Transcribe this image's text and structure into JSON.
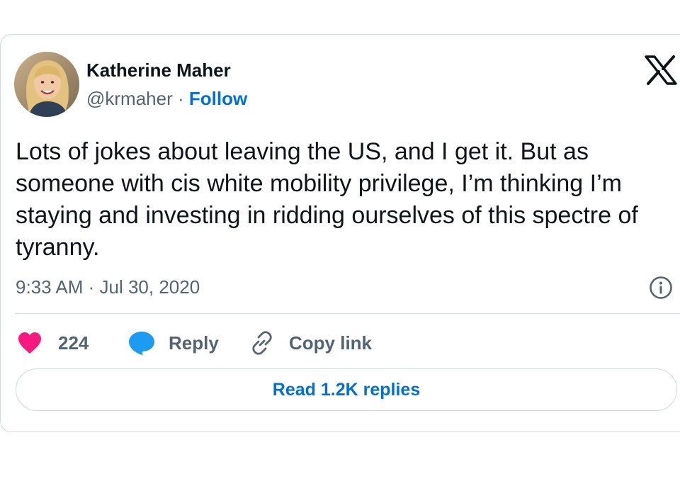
{
  "author": {
    "name": "Katherine Maher",
    "handle": "@krmaher",
    "separator": "·",
    "follow_label": "Follow"
  },
  "tweet": {
    "text": "Lots of jokes about leaving the US, and I get it. But as someone with cis white mobility privilege, I’m thinking I’m staying and investing in ridding ourselves of this spectre of tyranny.",
    "timestamp": "9:33 AM · Jul 30, 2020"
  },
  "actions": {
    "like_count": "224",
    "reply_label": "Reply",
    "copy_link_label": "Copy link"
  },
  "read_replies_label": "Read 1.2K replies",
  "icons": {
    "like": "heart-icon",
    "reply": "speech-bubble-icon",
    "copy": "link-icon",
    "info": "info-icon",
    "brand": "x-logo-icon"
  },
  "colors": {
    "heart": "#f91880",
    "reply_bubble": "#1d9bf0",
    "follow_link": "#006fd6",
    "secondary_text": "#536471",
    "border": "#cfd9de"
  }
}
